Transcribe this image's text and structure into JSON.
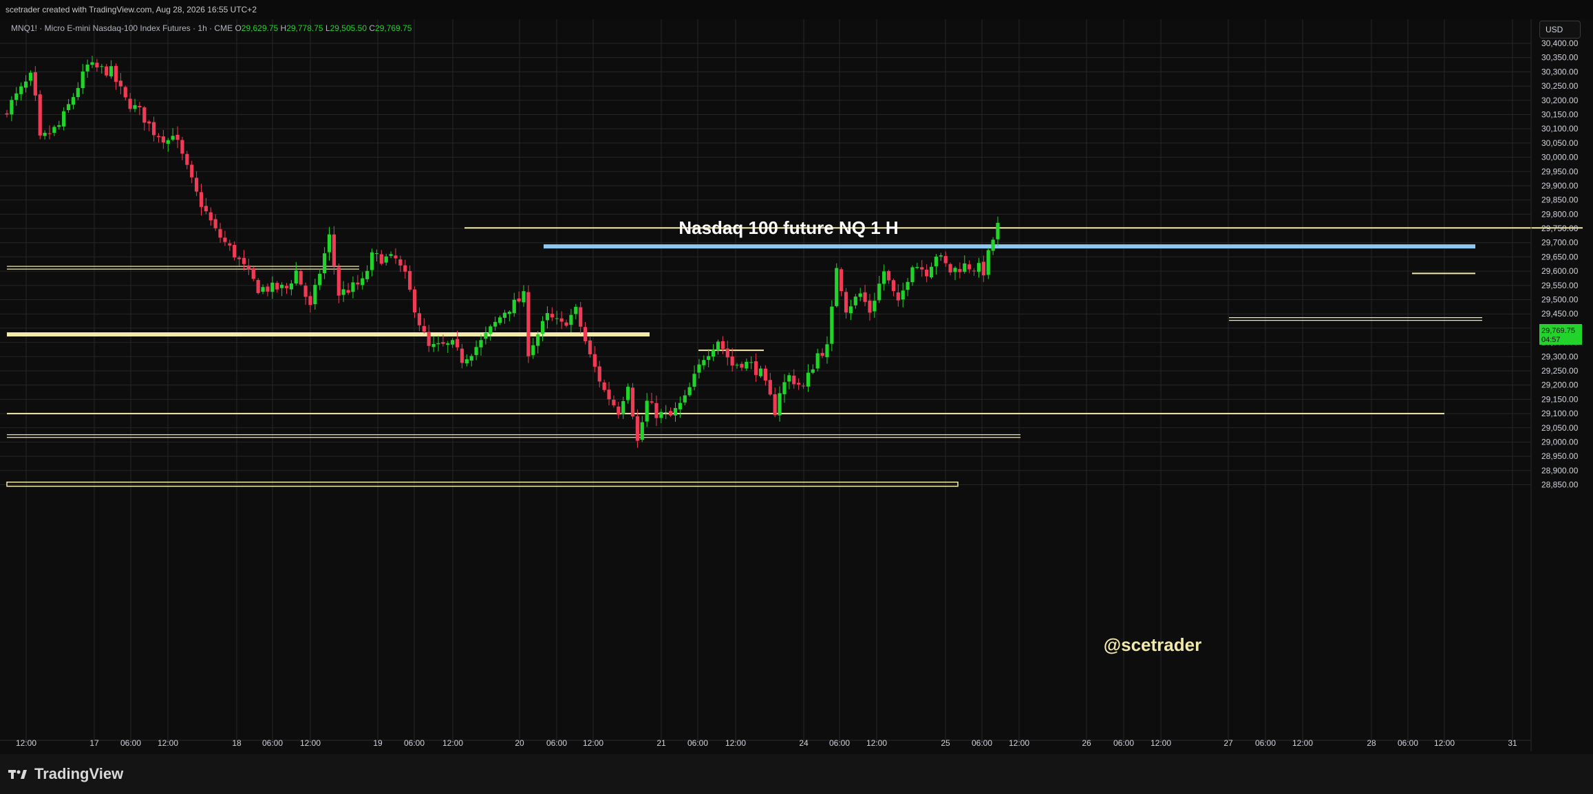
{
  "header": {
    "credit": "scetrader created with TradingView.com, Aug 28, 2026 16:55 UTC+2",
    "currency_button": "USD"
  },
  "legend": {
    "symbol": "MNQ1! · Micro E-mini Nasdaq-100 Index Futures · 1h · CME",
    "open_label": "O",
    "open": "29,629.75",
    "high_label": "H",
    "high": "29,778.75",
    "low_label": "L",
    "low": "29,505.50",
    "close_label": "C",
    "close": "29,769.75"
  },
  "price_tag": {
    "price": "29,769.75",
    "countdown": "04:57"
  },
  "footer": {
    "brand": "TradingView"
  },
  "colors": {
    "background": "#0d0d0d",
    "up": "#22d32b",
    "down": "#ef3b55",
    "level_line": "#f5eba8",
    "resistance": "#8ec7ef",
    "grid": "#262626"
  },
  "chart_data": {
    "type": "candlestick",
    "title": "Nasdaq 100 future NQ 1 H",
    "annotation": "@scetrader",
    "ylim": [
      28820,
      30440
    ],
    "y_ticks": [
      "30,400.00",
      "30,350.00",
      "30,300.00",
      "30,250.00",
      "30,200.00",
      "30,150.00",
      "30,100.00",
      "30,050.00",
      "30,000.00",
      "29,950.00",
      "29,900.00",
      "29,850.00",
      "29,800.00",
      "29,750.00",
      "29,700.00",
      "29,650.00",
      "29,600.00",
      "29,550.00",
      "29,500.00",
      "29,450.00",
      "29,400.00",
      "29,350.00",
      "29,300.00",
      "29,250.00",
      "29,200.00",
      "29,150.00",
      "29,100.00",
      "29,050.00",
      "29,000.00",
      "28,950.00",
      "28,900.00",
      "28,850.00"
    ],
    "x_ticks": [
      "12:00",
      "17",
      "06:00",
      "12:00",
      "18",
      "06:00",
      "12:00",
      "19",
      "06:00",
      "12:00",
      "20",
      "06:00",
      "12:00",
      "21",
      "06:00",
      "12:00",
      "24",
      "06:00",
      "12:00",
      "25",
      "06:00",
      "12:00",
      "26",
      "06:00",
      "12:00",
      "27",
      "06:00",
      "12:00",
      "28",
      "06:00",
      "12:00",
      "31"
    ],
    "candle_count": 190,
    "last_price": 29769.75,
    "path_anchors": [
      [
        0,
        30170
      ],
      [
        5,
        30280
      ],
      [
        6,
        30200
      ],
      [
        7,
        30060
      ],
      [
        11,
        30110
      ],
      [
        17,
        30320
      ],
      [
        22,
        30300
      ],
      [
        25,
        30200
      ],
      [
        28,
        30160
      ],
      [
        31,
        30090
      ],
      [
        34,
        30060
      ],
      [
        35,
        30090
      ],
      [
        40,
        29870
      ],
      [
        44,
        29740
      ],
      [
        48,
        29660
      ],
      [
        53,
        29540
      ],
      [
        59,
        29540
      ],
      [
        61,
        29600
      ],
      [
        64,
        29470
      ],
      [
        67,
        29660
      ],
      [
        68,
        29720
      ],
      [
        70,
        29520
      ],
      [
        75,
        29560
      ],
      [
        77,
        29650
      ],
      [
        82,
        29640
      ],
      [
        84,
        29580
      ],
      [
        87,
        29420
      ],
      [
        89,
        29330
      ],
      [
        94,
        29340
      ],
      [
        96,
        29290
      ],
      [
        100,
        29350
      ],
      [
        105,
        29460
      ],
      [
        109,
        29510
      ],
      [
        110,
        29320
      ],
      [
        114,
        29440
      ],
      [
        117,
        29410
      ],
      [
        120,
        29460
      ],
      [
        123,
        29300
      ],
      [
        126,
        29180
      ],
      [
        129,
        29110
      ],
      [
        131,
        29210
      ],
      [
        133,
        29000
      ],
      [
        135,
        29140
      ],
      [
        137,
        29100
      ],
      [
        140,
        29090
      ],
      [
        143,
        29150
      ],
      [
        147,
        29300
      ],
      [
        150,
        29360
      ],
      [
        153,
        29270
      ],
      [
        155,
        29280
      ],
      [
        157,
        29270
      ],
      [
        159,
        29240
      ],
      [
        162,
        29110
      ],
      [
        163,
        29180
      ],
      [
        165,
        29230
      ],
      [
        168,
        29190
      ],
      [
        171,
        29310
      ],
      [
        173,
        29330
      ],
      [
        174,
        29460
      ],
      [
        175,
        29620
      ],
      [
        177,
        29470
      ],
      [
        180,
        29520
      ],
      [
        182,
        29460
      ],
      [
        185,
        29600
      ],
      [
        188,
        29480
      ],
      [
        191,
        29630
      ],
      [
        194,
        29600
      ],
      [
        196,
        29660
      ],
      [
        199,
        29600
      ],
      [
        202,
        29620
      ],
      [
        205,
        29610
      ],
      [
        206,
        29600
      ],
      [
        209,
        29769
      ]
    ],
    "horizontal_levels": [
      {
        "price": 29752,
        "style": "thin"
      },
      {
        "price": 29687,
        "style": "resistance"
      },
      {
        "price": 29612,
        "style": "double"
      },
      {
        "price": 29592,
        "style": "short"
      },
      {
        "price": 29432,
        "style": "double"
      },
      {
        "price": 29378,
        "style": "thick"
      },
      {
        "price": 29322,
        "style": "short"
      },
      {
        "price": 29100,
        "style": "thin"
      },
      {
        "price": 29021,
        "style": "double"
      },
      {
        "price": 28852,
        "style": "band"
      }
    ]
  }
}
